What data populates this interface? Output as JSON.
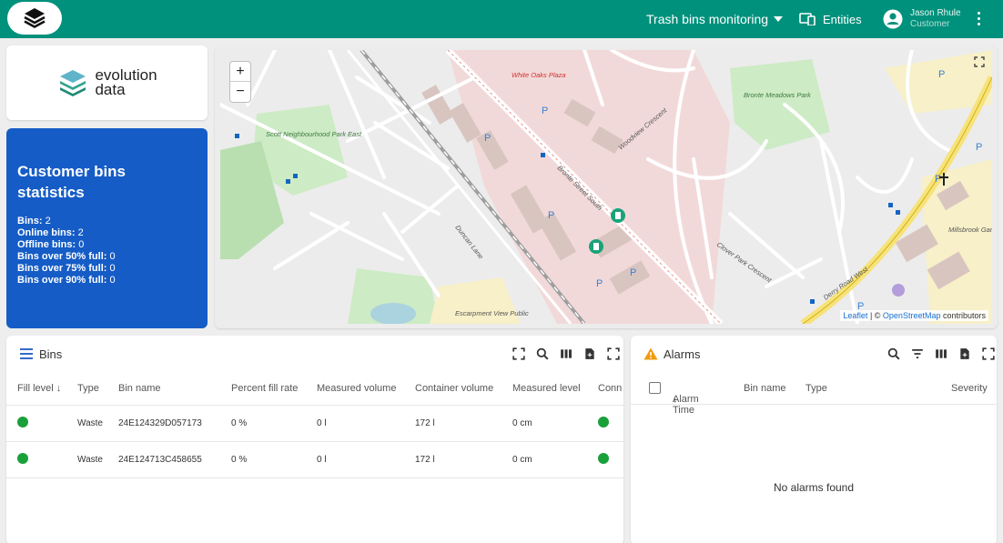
{
  "topbar": {
    "dashboard_title": "Trash bins monitoring",
    "entities_label": "Entities",
    "user_name": "Jason Rhule",
    "user_role": "Customer"
  },
  "brand": {
    "line1": "evolution",
    "line2": "data"
  },
  "stats": {
    "title_line1": "Customer bins",
    "title_line2": "statistics",
    "items": [
      {
        "label": "Bins:",
        "value": "2"
      },
      {
        "label": "Online bins:",
        "value": "2"
      },
      {
        "label": "Offline bins:",
        "value": "0"
      },
      {
        "label": "Bins over 50% full:",
        "value": "0"
      },
      {
        "label": "Bins over 75% full:",
        "value": "0"
      },
      {
        "label": "Bins over 90% full:",
        "value": "0"
      }
    ]
  },
  "map": {
    "zoom_in": "+",
    "zoom_out": "−",
    "attribution_leaflet": "Leaflet",
    "attribution_sep": " | © ",
    "attribution_osm": "OpenStreetMap",
    "attribution_tail": " contributors",
    "labels": {
      "white_oaks": "White Oaks Plaza",
      "bronte_meadows": "Bronte Meadows Park",
      "scott_park": "Scott Neighbourhood Park East",
      "bronte_st": "Bronte Street South",
      "duncan": "Duncan Lane",
      "woodview": "Woodview Crescent",
      "derry": "Derry Road West",
      "clover": "Clover Park Crescent",
      "millsbrook": "Millsbrook Gardens",
      "escarpment": "Escarpment View Public"
    }
  },
  "bins": {
    "title": "Bins",
    "columns": [
      "Fill level",
      "Type",
      "Bin name",
      "Percent fill rate",
      "Measured volume",
      "Container volume",
      "Measured level",
      "Conn"
    ],
    "rows": [
      {
        "type": "Waste",
        "name": "24E124329D057173",
        "percent": "0 %",
        "volume": "0 l",
        "container": "172 l",
        "level": "0 cm"
      },
      {
        "type": "Waste",
        "name": "24E124713C458655",
        "percent": "0 %",
        "volume": "0 l",
        "container": "172 l",
        "level": "0 cm"
      }
    ]
  },
  "alarms": {
    "title": "Alarms",
    "columns": {
      "time": "Alarm Time",
      "bin": "Bin name",
      "type": "Type",
      "severity": "Severity"
    },
    "empty": "No alarms found"
  },
  "colors": {
    "topbar": "#00917c",
    "stats_bg": "#155cc6",
    "status_green": "#1aa03a",
    "warning": "#f29b0e"
  }
}
